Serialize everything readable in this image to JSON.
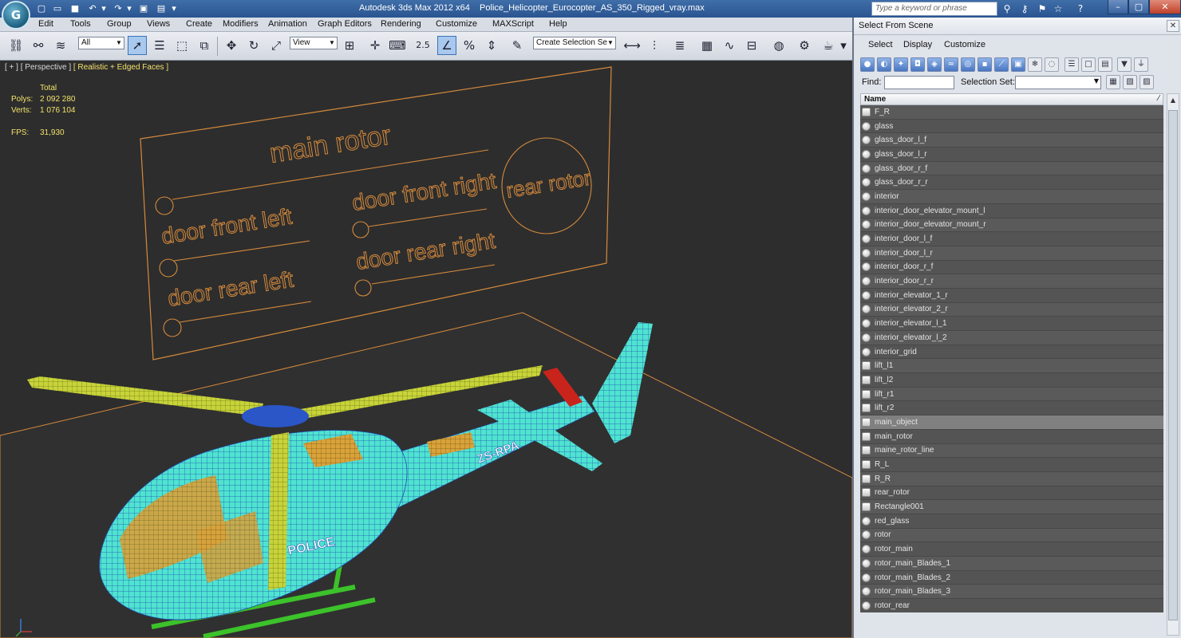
{
  "titlebar": {
    "app_title": "Autodesk 3ds Max  2012 x64",
    "file_title": "Police_Helicopter_Eurocopter_AS_350_Rigged_vray.max",
    "search_placeholder": "Type a keyword or phrase",
    "logo_letter": "G"
  },
  "menu": [
    "Edit",
    "Tools",
    "Group",
    "Views",
    "Create",
    "Modifiers",
    "Animation",
    "Graph Editors",
    "Rendering",
    "Customize",
    "MAXScript",
    "Help"
  ],
  "toolbar": {
    "filter_combo": "All",
    "ref_coord_combo": "View",
    "snap_angle_label": "2.5",
    "selection_set_combo": "Create Selection Se"
  },
  "viewport": {
    "label_plus": "[ + ]",
    "label_view": "[ Perspective ]",
    "label_shading": "[ Realistic + Edged Faces ]",
    "stats": {
      "total_label": "Total",
      "polys_label": "Polys:",
      "polys_value": "2 092 280",
      "verts_label": "Verts:",
      "verts_value": "1 076 104",
      "fps_label": "FPS:",
      "fps_value": "31,930"
    },
    "panel_labels": {
      "main_rotor": "main rotor",
      "rear_rotor": "rear rotor",
      "door_front_left": "door front left",
      "door_front_right": "door front right",
      "door_rear_left": "door rear left",
      "door_rear_right": "door rear right"
    },
    "heli_text": {
      "registration": "ZS-RPA",
      "police": "POLICE"
    }
  },
  "dialog": {
    "title": "Select From Scene",
    "menu": [
      "Select",
      "Display",
      "Customize"
    ],
    "find_label": "Find:",
    "find_value": "",
    "selection_set_label": "Selection Set:",
    "selection_set_value": "",
    "column_name": "Name",
    "selected_item": "main_object",
    "items": [
      {
        "name": "F_R",
        "icon": "shape"
      },
      {
        "name": "glass",
        "icon": "sphere"
      },
      {
        "name": "glass_door_l_f",
        "icon": "sphere"
      },
      {
        "name": "glass_door_l_r",
        "icon": "sphere"
      },
      {
        "name": "glass_door_r_f",
        "icon": "sphere"
      },
      {
        "name": "glass_door_r_r",
        "icon": "sphere"
      },
      {
        "name": "interior",
        "icon": "sphere"
      },
      {
        "name": "interior_door_elevator_mount_l",
        "icon": "sphere"
      },
      {
        "name": "interior_door_elevator_mount_r",
        "icon": "sphere"
      },
      {
        "name": "interior_door_l_f",
        "icon": "sphere"
      },
      {
        "name": "interior_door_l_r",
        "icon": "sphere"
      },
      {
        "name": "interior_door_r_f",
        "icon": "sphere"
      },
      {
        "name": "interior_door_r_r",
        "icon": "sphere"
      },
      {
        "name": "interior_elevator_1_r",
        "icon": "sphere"
      },
      {
        "name": "interior_elevator_2_r",
        "icon": "sphere"
      },
      {
        "name": "interior_elevator_l_1",
        "icon": "sphere"
      },
      {
        "name": "interior_elevator_l_2",
        "icon": "sphere"
      },
      {
        "name": "interior_grid",
        "icon": "sphere"
      },
      {
        "name": "lift_l1",
        "icon": "shape"
      },
      {
        "name": "lift_l2",
        "icon": "shape"
      },
      {
        "name": "lift_r1",
        "icon": "shape"
      },
      {
        "name": "lift_r2",
        "icon": "shape"
      },
      {
        "name": "main_object",
        "icon": "shape"
      },
      {
        "name": "main_rotor",
        "icon": "shape"
      },
      {
        "name": "maine_rotor_line",
        "icon": "shape"
      },
      {
        "name": "R_L",
        "icon": "shape"
      },
      {
        "name": "R_R",
        "icon": "shape"
      },
      {
        "name": "rear_rotor",
        "icon": "shape"
      },
      {
        "name": "Rectangle001",
        "icon": "shape"
      },
      {
        "name": "red_glass",
        "icon": "sphere"
      },
      {
        "name": "rotor",
        "icon": "sphere"
      },
      {
        "name": "rotor_main",
        "icon": "sphere"
      },
      {
        "name": "rotor_main_Blades_1",
        "icon": "sphere"
      },
      {
        "name": "rotor_main_Blades_2",
        "icon": "sphere"
      },
      {
        "name": "rotor_main_Blades_3",
        "icon": "sphere"
      },
      {
        "name": "rotor_rear",
        "icon": "sphere"
      }
    ]
  },
  "colors": {
    "viewport_bg": "#2d2d2d",
    "wire_orange": "#d58a3c",
    "stat_yellow": "#f2e36a",
    "heli_cyan": "#4fe3d0",
    "rotor_yellow": "#c8d33a",
    "skid_green": "#3cc22a",
    "hub_blue": "#2a56c8",
    "title_blue": "#2a5490"
  }
}
